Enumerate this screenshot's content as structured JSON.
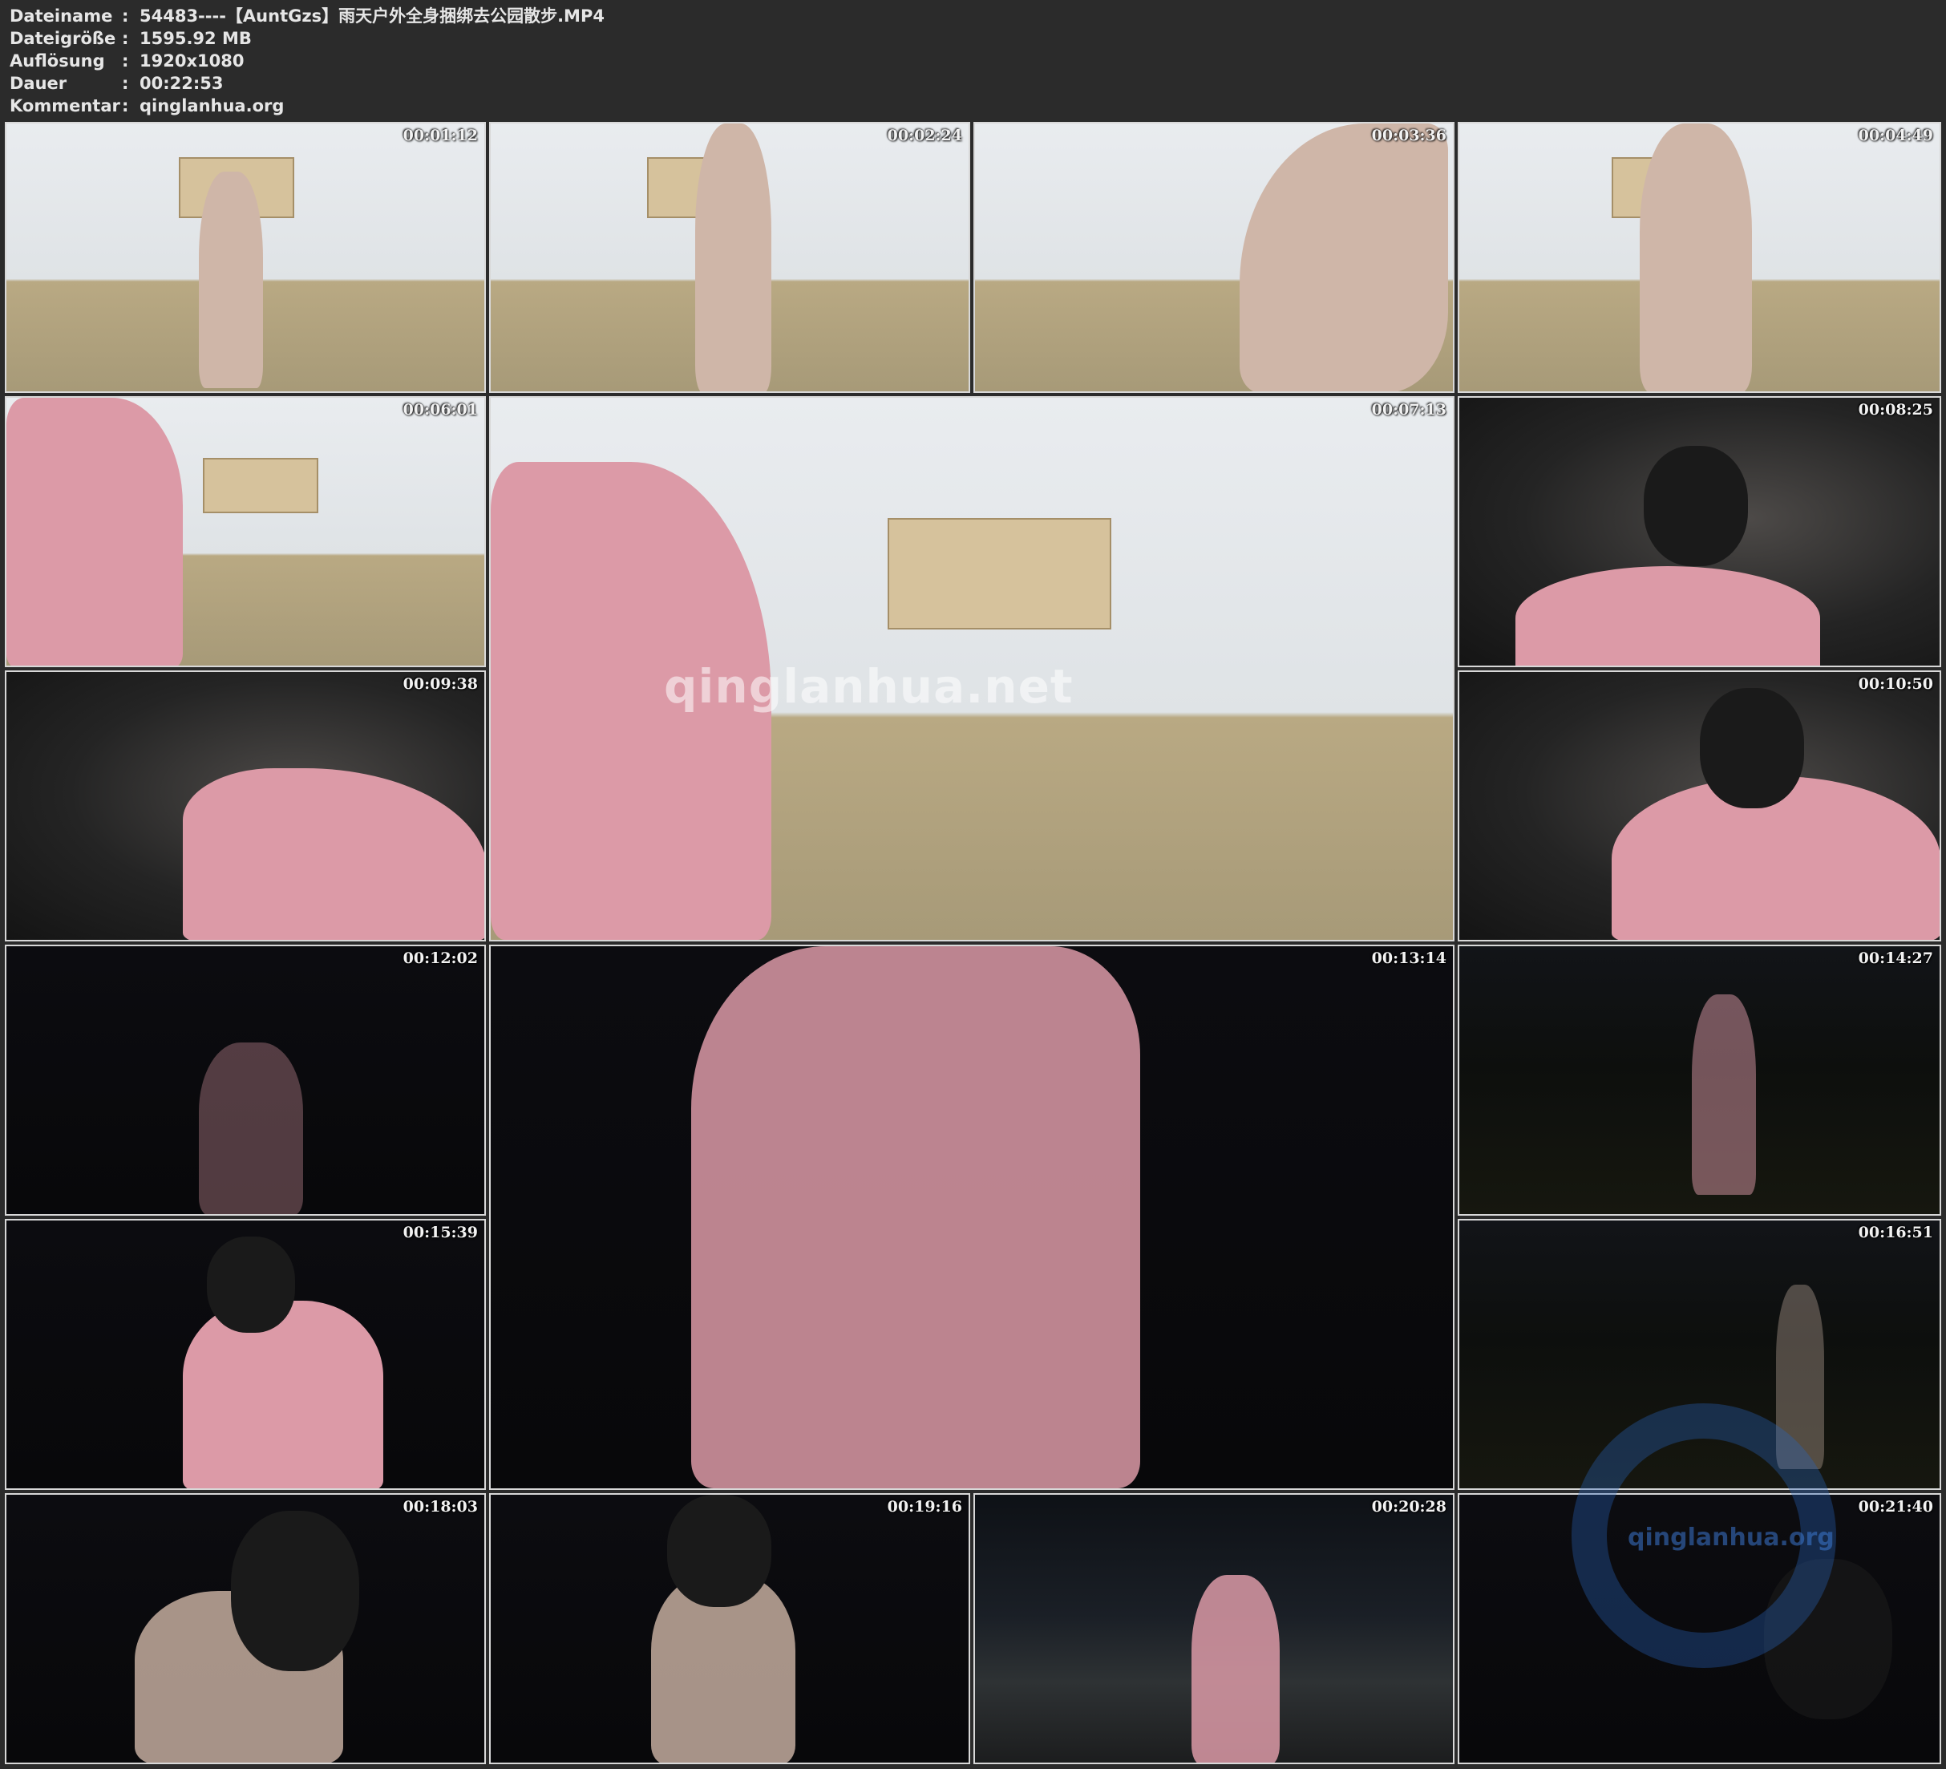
{
  "header": {
    "rows": [
      {
        "key": "Dateiname",
        "sep": ":",
        "value": "54483----【AuntGzs】雨天户外全身捆绑去公园散步.MP4"
      },
      {
        "key": "Dateigröße",
        "sep": ":",
        "value": "1595.92 MB"
      },
      {
        "key": "Auflösung",
        "sep": ":",
        "value": "1920x1080"
      },
      {
        "key": "Dauer",
        "sep": ":",
        "value": "00:22:53"
      },
      {
        "key": "Kommentar",
        "sep": ":",
        "value": "qinglanhua.org"
      }
    ]
  },
  "thumbnails": [
    {
      "time": "00:01:12",
      "scene": "indoor"
    },
    {
      "time": "00:02:24",
      "scene": "indoor"
    },
    {
      "time": "00:03:36",
      "scene": "indoor"
    },
    {
      "time": "00:04:49",
      "scene": "indoor"
    },
    {
      "time": "00:06:01",
      "scene": "indoor"
    },
    {
      "time": "00:07:13",
      "scene": "indoor"
    },
    {
      "time": "00:08:25",
      "scene": "car"
    },
    {
      "time": "00:09:38",
      "scene": "car"
    },
    {
      "time": "00:10:50",
      "scene": "car"
    },
    {
      "time": "00:12:02",
      "scene": "night"
    },
    {
      "time": "00:13:14",
      "scene": "night"
    },
    {
      "time": "00:14:27",
      "scene": "night"
    },
    {
      "time": "00:15:39",
      "scene": "night"
    },
    {
      "time": "00:16:51",
      "scene": "night"
    },
    {
      "time": "00:18:03",
      "scene": "night"
    },
    {
      "time": "00:19:16",
      "scene": "night"
    },
    {
      "time": "00:20:28",
      "scene": "road"
    },
    {
      "time": "00:21:40",
      "scene": "night"
    }
  ],
  "watermarks": {
    "center": "qinglanhua.net",
    "corner": "qinglanhua.org"
  }
}
